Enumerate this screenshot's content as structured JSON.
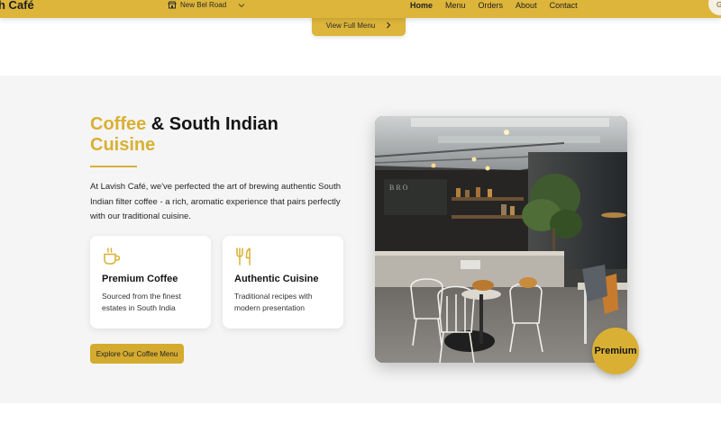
{
  "nav": {
    "brand": "h Café",
    "location": "New Bel Road",
    "links": [
      "Home",
      "Menu",
      "Orders",
      "About",
      "Contact"
    ],
    "active_link": "Home",
    "corner_button": "G"
  },
  "menu_button": {
    "label": "View Full Menu"
  },
  "coffee_section": {
    "heading_highlight": "Coffee",
    "heading_rest": " & South Indian",
    "heading_line2": "Cuisine",
    "intro": "At Lavish Café, we've perfected the art of brewing authentic South Indian filter coffee - a rich, aromatic experience that pairs perfectly with our traditional cuisine.",
    "cards": [
      {
        "icon": "coffee-cup-icon",
        "title": "Premium Coffee",
        "text": "Sourced from the finest estates in South India"
      },
      {
        "icon": "fork-knife-icon",
        "title": "Authentic Cuisine",
        "text": "Traditional recipes with modern presentation"
      }
    ],
    "cta": "Explore Our Coffee Menu",
    "badge": "Premium"
  },
  "colors": {
    "accent": "#d9b033",
    "nav_background": "#dcb53a",
    "section_background": "#f5f5f5"
  }
}
